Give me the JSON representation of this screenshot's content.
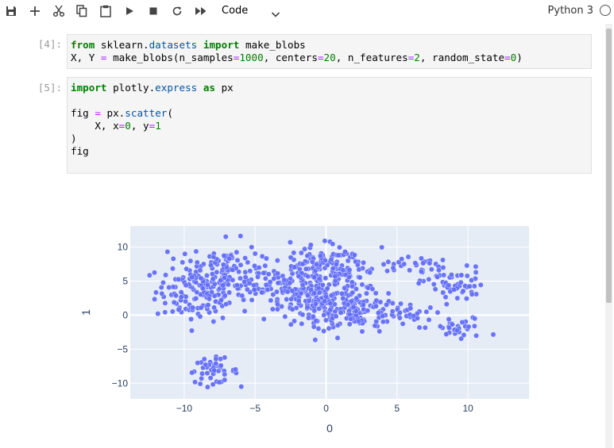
{
  "toolbar": {
    "buttons": [
      {
        "name": "save-icon"
      },
      {
        "name": "add-cell-icon"
      },
      {
        "name": "cut-icon"
      },
      {
        "name": "copy-icon"
      },
      {
        "name": "paste-icon"
      },
      {
        "name": "run-icon"
      },
      {
        "name": "stop-icon"
      },
      {
        "name": "restart-icon"
      },
      {
        "name": "restart-run-all-icon"
      }
    ],
    "cell_type": "Code",
    "kernel": "Python 3"
  },
  "cells": [
    {
      "prompt": "[4]:",
      "lines": [
        "from sklearn.datasets import make_blobs",
        "X, Y = make_blobs(n_samples=1000, centers=20, n_features=2, random_state=0)"
      ]
    },
    {
      "prompt": "[5]:",
      "lines": [
        "import plotly.express as px",
        "",
        "fig = px.scatter(",
        "    X, x=0, y=1",
        ")",
        "fig"
      ]
    }
  ],
  "chart_data": {
    "type": "scatter",
    "title": "",
    "xlabel": "0",
    "ylabel": "1",
    "xlim": [
      -13.8,
      14.3
    ],
    "ylim": [
      -12.3,
      13.1
    ],
    "xticks": [
      -10,
      -5,
      0,
      5,
      10
    ],
    "yticks": [
      -10,
      -5,
      0,
      5,
      10
    ],
    "x_tick_labels": [
      "−10",
      "−5",
      "0",
      "5",
      "10"
    ],
    "y_tick_labels": [
      "−10",
      "−5",
      "0",
      "5",
      "10"
    ],
    "grid": true,
    "marker_color": "#636efa",
    "plot_bgcolor": "#e5ecf6",
    "clusters": [
      {
        "cx": -9.0,
        "cy": 3.5,
        "sx": 1.5,
        "sy": 2.2,
        "n": 150
      },
      {
        "cx": -7.0,
        "cy": 7.0,
        "sx": 1.2,
        "sy": 2.0,
        "n": 80
      },
      {
        "cx": -4.5,
        "cy": 5.0,
        "sx": 1.2,
        "sy": 1.3,
        "n": 50
      },
      {
        "cx": -8.0,
        "cy": -8.2,
        "sx": 0.9,
        "sy": 0.9,
        "n": 45
      },
      {
        "cx": -2.0,
        "cy": 3.5,
        "sx": 1.2,
        "sy": 2.2,
        "n": 60
      },
      {
        "cx": -0.5,
        "cy": 6.5,
        "sx": 1.3,
        "sy": 1.8,
        "n": 110
      },
      {
        "cx": 1.5,
        "cy": 5.5,
        "sx": 1.2,
        "sy": 2.2,
        "n": 80
      },
      {
        "cx": -0.5,
        "cy": 1.5,
        "sx": 1.4,
        "sy": 1.8,
        "n": 90
      },
      {
        "cx": 2.0,
        "cy": 0.5,
        "sx": 1.5,
        "sy": 1.5,
        "n": 100
      },
      {
        "cx": 5.5,
        "cy": 0.0,
        "sx": 1.0,
        "sy": 1.0,
        "n": 30
      },
      {
        "cx": 6.0,
        "cy": 7.5,
        "sx": 1.0,
        "sy": 0.6,
        "n": 25
      },
      {
        "cx": 9.0,
        "cy": 4.5,
        "sx": 1.1,
        "sy": 1.3,
        "n": 60
      },
      {
        "cx": 9.5,
        "cy": -2.0,
        "sx": 1.0,
        "sy": 0.9,
        "n": 30
      }
    ]
  }
}
